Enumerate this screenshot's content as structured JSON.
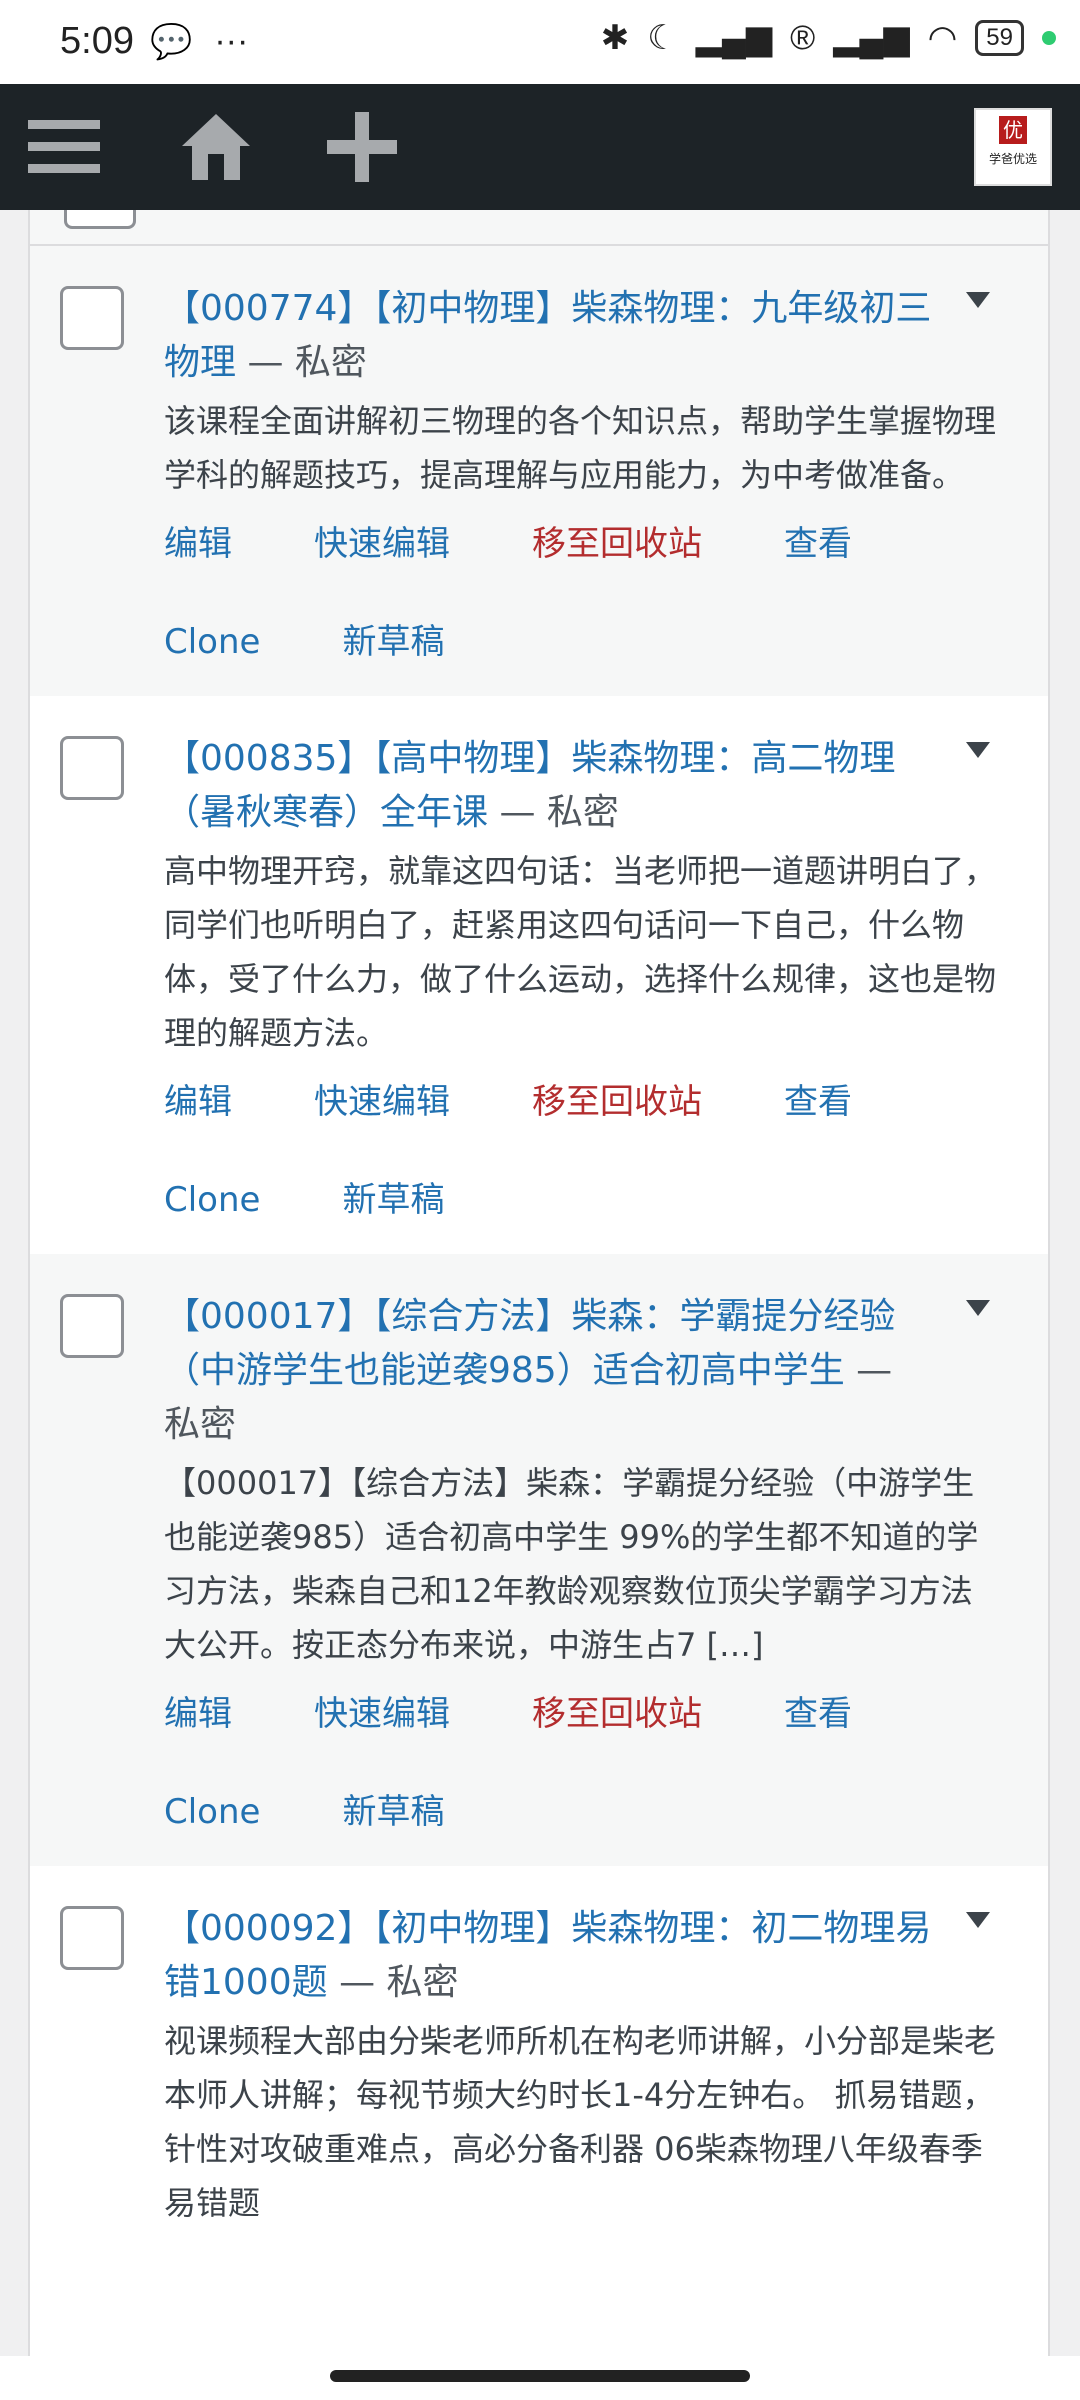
{
  "status": {
    "time": "5:09",
    "battery": "59"
  },
  "adminbar": {
    "logo_text": "学爸优选",
    "logo_mark": "优"
  },
  "posts": [
    {
      "title": "【000774】【初中物理】柴森物理：九年级初三物理",
      "state": " — 私密",
      "excerpt": "该课程全面讲解初三物理的各个知识点，帮助学生掌握物理学科的解题技巧，提高理解与应用能力，为中考做准备。"
    },
    {
      "title": "【000835】【高中物理】柴森物理：高二物理（暑秋寒春）全年课",
      "state": " — 私密",
      "excerpt": "高中物理开窍，就靠这四句话：当老师把一道题讲明白了，同学们也听明白了，赶紧用这四句话问一下自己，什么物体，受了什么力，做了什么运动，选择什么规律，这也是物理的解题方法。"
    },
    {
      "title": "【000017】【综合方法】柴森：学霸提分经验（中游学生也能逆袭985）适合初高中学生",
      "state": " — 私密",
      "excerpt": "【000017】【综合方法】柴森：学霸提分经验（中游学生也能逆袭985）适合初高中学生 99%的学生都不知道的学习方法，柴森自己和12年教龄观察数位顶尖学霸学习方法大公开。按正态分布来说，中游生占7 […]"
    },
    {
      "title": "【000092】【初中物理】柴森物理：初二物理易错1000题",
      "state": " — 私密",
      "excerpt": "视课频程大部由分柴老师所机在构老师讲解，小分部是柴老本师人讲解；每视节频大约时长1-4分左钟右。 抓易错题，针性对攻破重难点，高必分备利器 06柴森物理八年级春季易错题"
    }
  ],
  "actions": {
    "edit": "编辑",
    "quick_edit": "快速编辑",
    "trash": "移至回收站",
    "view": "查看",
    "clone": "Clone",
    "new_draft": "新草稿"
  }
}
